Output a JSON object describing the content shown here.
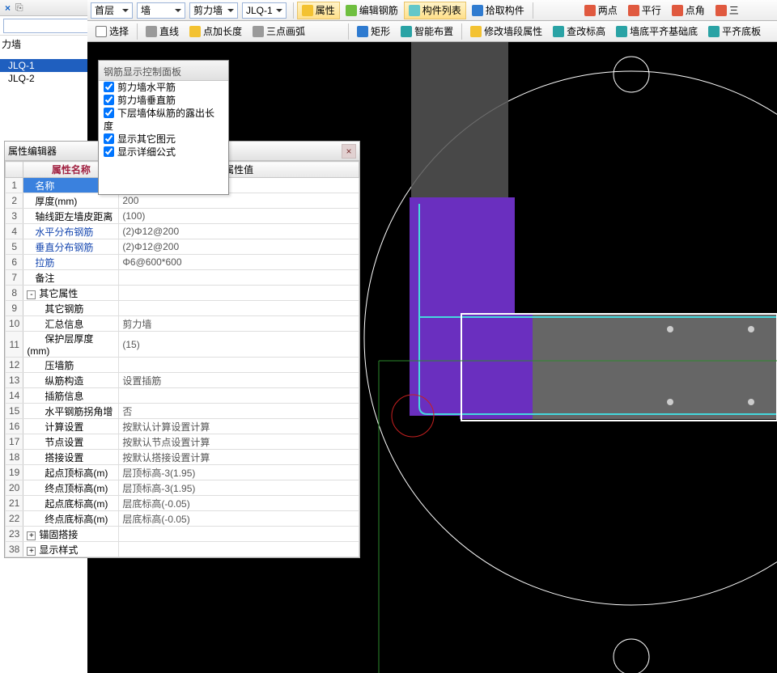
{
  "leftHead": {
    "close": "×",
    "copy": "⎘"
  },
  "topDropdown": {
    "top": "首层",
    "cat": "墙",
    "sub": "剪力墙",
    "code": "JLQ-1"
  },
  "tb1": {
    "attr": "属性",
    "editRebar": "编辑钢筋",
    "list": "构件列表",
    "pick": "拾取构件",
    "twoPts": "两点",
    "parallel": "平行",
    "ptAngle": "点角",
    "tri": "三"
  },
  "tb2": {
    "select": "选择",
    "line": "直线",
    "ptExtend": "点加长度",
    "arc3": "三点画弧",
    "rect": "矩形",
    "smart": "智能布置",
    "adjWall": "修改墙段属性",
    "checkElev": "查改标高",
    "flushFoot": "墙底平齐基础底",
    "flushBot": "平齐底板"
  },
  "left": {
    "title": "力墙",
    "items": [
      "JLQ-1",
      "JLQ-2"
    ]
  },
  "popup": {
    "title": "钢筋显示控制面板",
    "opts": [
      "剪力墙水平筋",
      "剪力墙垂直筋",
      "下层墙体纵筋的露出长度",
      "显示其它图元",
      "显示详细公式"
    ]
  },
  "prop": {
    "title": "属性编辑器",
    "h1": "属性名称",
    "h2": "属性值",
    "rows": [
      {
        "n": "1",
        "lbl": "名称",
        "val": "",
        "cls": "selName"
      },
      {
        "n": "2",
        "lbl": "厚度(mm)",
        "val": "200"
      },
      {
        "n": "3",
        "lbl": "轴线距左墙皮距离",
        "val": "(100)"
      },
      {
        "n": "4",
        "lbl": "水平分布钢筋",
        "val": "(2)Φ12@200",
        "blue": true
      },
      {
        "n": "5",
        "lbl": "垂直分布钢筋",
        "val": "(2)Φ12@200",
        "blue": true
      },
      {
        "n": "6",
        "lbl": "拉筋",
        "val": "Φ6@600*600",
        "blue": true
      },
      {
        "n": "7",
        "lbl": "备注",
        "val": ""
      },
      {
        "n": "8",
        "lbl": "其它属性",
        "val": "",
        "group": true,
        "exp": "-"
      },
      {
        "n": "9",
        "lbl": "其它钢筋",
        "val": "",
        "child": true
      },
      {
        "n": "10",
        "lbl": "汇总信息",
        "val": "剪力墙",
        "child": true
      },
      {
        "n": "11",
        "lbl": "保护层厚度(mm)",
        "val": "(15)",
        "child": true
      },
      {
        "n": "12",
        "lbl": "压墙筋",
        "val": "",
        "child": true
      },
      {
        "n": "13",
        "lbl": "纵筋构造",
        "val": "设置插筋",
        "child": true
      },
      {
        "n": "14",
        "lbl": "插筋信息",
        "val": "",
        "child": true
      },
      {
        "n": "15",
        "lbl": "水平钢筋拐角增",
        "val": "否",
        "child": true
      },
      {
        "n": "16",
        "lbl": "计算设置",
        "val": "按默认计算设置计算",
        "child": true
      },
      {
        "n": "17",
        "lbl": "节点设置",
        "val": "按默认节点设置计算",
        "child": true
      },
      {
        "n": "18",
        "lbl": "搭接设置",
        "val": "按默认搭接设置计算",
        "child": true
      },
      {
        "n": "19",
        "lbl": "起点顶标高(m)",
        "val": "层顶标高-3(1.95)",
        "child": true
      },
      {
        "n": "20",
        "lbl": "终点顶标高(m)",
        "val": "层顶标高-3(1.95)",
        "child": true
      },
      {
        "n": "21",
        "lbl": "起点底标高(m)",
        "val": "层底标高(-0.05)",
        "child": true
      },
      {
        "n": "22",
        "lbl": "终点底标高(m)",
        "val": "层底标高(-0.05)",
        "child": true
      },
      {
        "n": "23",
        "lbl": "锚固搭接",
        "val": "",
        "group": true,
        "exp": "+"
      },
      {
        "n": "38",
        "lbl": "显示样式",
        "val": "",
        "group": true,
        "exp": "+"
      }
    ]
  }
}
